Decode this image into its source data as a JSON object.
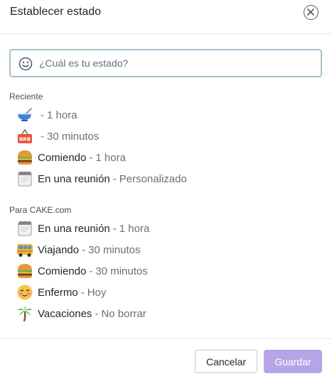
{
  "dialog": {
    "title": "Establecer estado"
  },
  "search": {
    "placeholder": "¿Cuál es tu estado?"
  },
  "recent": {
    "title": "Reciente",
    "items": [
      {
        "icon": "bowl-icon",
        "text": "",
        "separator": "-",
        "duration": "1 hora"
      },
      {
        "icon": "brb-sign-icon",
        "text": "",
        "separator": "-",
        "duration": "30 minutos"
      },
      {
        "icon": "hamburger-icon",
        "text": "Comiendo",
        "separator": "-",
        "duration": "1 hora"
      },
      {
        "icon": "calendar-icon",
        "text": "En una reunión",
        "separator": "-",
        "duration": "Personalizado"
      }
    ]
  },
  "workspace": {
    "title": "Para CAKE.com",
    "items": [
      {
        "icon": "calendar-icon",
        "text": "En una reunión",
        "separator": "-",
        "duration": "1 hora"
      },
      {
        "icon": "bus-icon",
        "text": "Viajando",
        "separator": "-",
        "duration": "30 minutos"
      },
      {
        "icon": "hamburger-icon",
        "text": "Comiendo",
        "separator": "-",
        "duration": "30 minutos"
      },
      {
        "icon": "sick-face-icon",
        "text": "Enfermo",
        "separator": "-",
        "duration": "Hoy"
      },
      {
        "icon": "palm-tree-icon",
        "text": "Vacaciones",
        "separator": "-",
        "duration": "No borrar"
      }
    ]
  },
  "brb_label": "BRB",
  "footer": {
    "cancel_label": "Cancelar",
    "save_label": "Guardar"
  },
  "colors": {
    "save_disabled": "#b6a5e6",
    "search_border": "#a8c0cf"
  }
}
